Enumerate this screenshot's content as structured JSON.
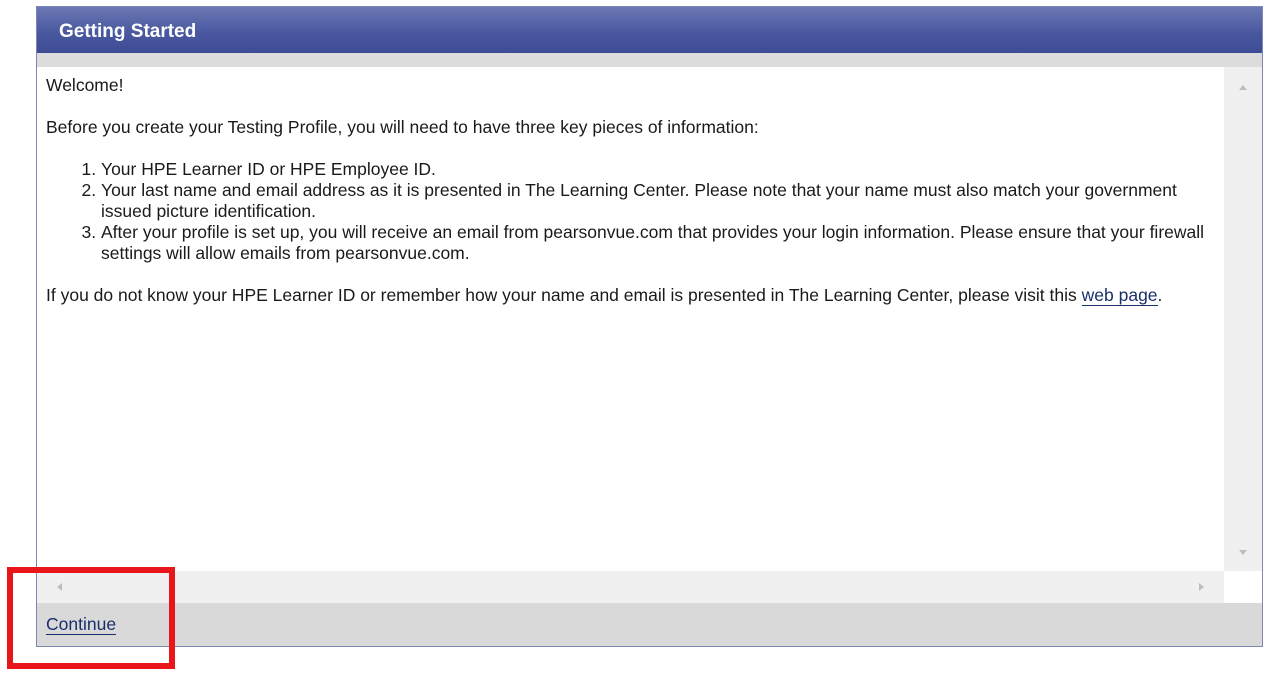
{
  "panel": {
    "title": "Getting Started"
  },
  "content": {
    "welcome": "Welcome!",
    "intro": "Before you create your Testing Profile, you will need to have three key pieces of information:",
    "items": [
      "Your HPE Learner ID or HPE Employee ID.",
      "Your last name and email address as it is presented in The Learning Center. Please note that your name must also match your government issued picture identification.",
      "After your profile is set up, you will receive an email from pearsonvue.com that provides your login information. Please ensure that your firewall settings will allow emails from pearsonvue.com."
    ],
    "help_before_link": "If you do not know your HPE Learner ID or remember how your name and email is presented in The Learning Center, please visit this ",
    "help_link": "web page",
    "help_after_link": "."
  },
  "footer": {
    "continue_label": "Continue"
  },
  "colors": {
    "header": "#4a58a0",
    "link": "#1a2f6b",
    "highlight": "#e8161b"
  },
  "icons": {
    "scroll_up": "chevron-up-icon",
    "scroll_down": "chevron-down-icon",
    "scroll_left": "chevron-left-icon",
    "scroll_right": "chevron-right-icon"
  }
}
